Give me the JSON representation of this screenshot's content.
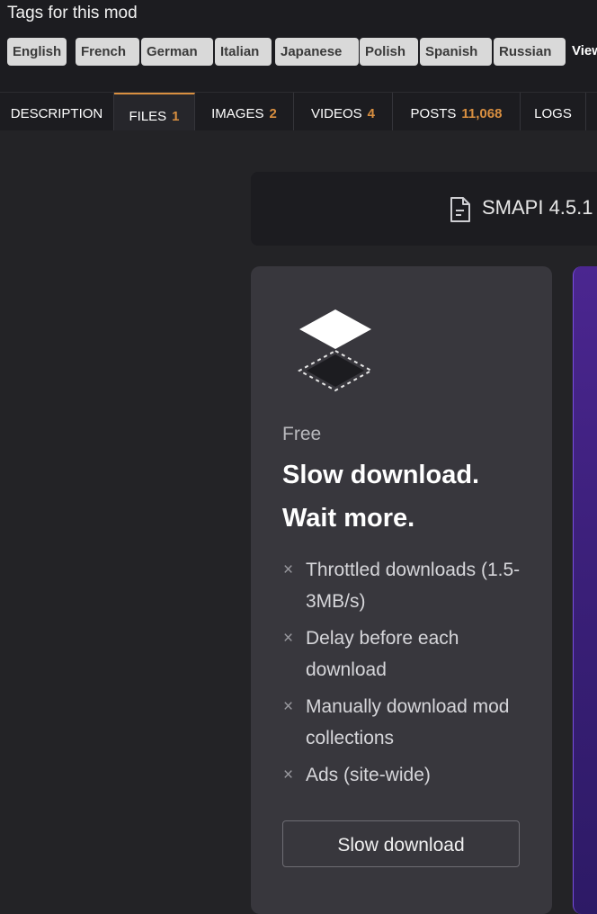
{
  "colors": {
    "accent": "#d98f40",
    "background": "#232326",
    "card": "#38373d",
    "premium": "#4b2690"
  },
  "tags": {
    "title": "Tags for this mod",
    "items": [
      "English",
      "French",
      "German",
      "Italian",
      "Japanese",
      "Polish",
      "Spanish",
      "Russian"
    ],
    "view_all": "View"
  },
  "tabs": [
    {
      "label": "DESCRIPTION",
      "count": ""
    },
    {
      "label": "FILES",
      "count": "1"
    },
    {
      "label": "IMAGES",
      "count": "2"
    },
    {
      "label": "VIDEOS",
      "count": "4"
    },
    {
      "label": "POSTS",
      "count": "11,068"
    },
    {
      "label": "LOGS",
      "count": ""
    }
  ],
  "active_tab": "FILES",
  "file": {
    "icon": "document-icon",
    "name": "SMAPI 4.5.1 ("
  },
  "free_plan": {
    "icon": "layers-icon",
    "label": "Free",
    "title_line1": "Slow download.",
    "title_line2": "Wait more.",
    "features": [
      "Throttled downloads (1.5-3MB/s)",
      "Delay before each download",
      "Manually download mod collections",
      "Ads (site-wide)"
    ],
    "button": "Slow download"
  }
}
